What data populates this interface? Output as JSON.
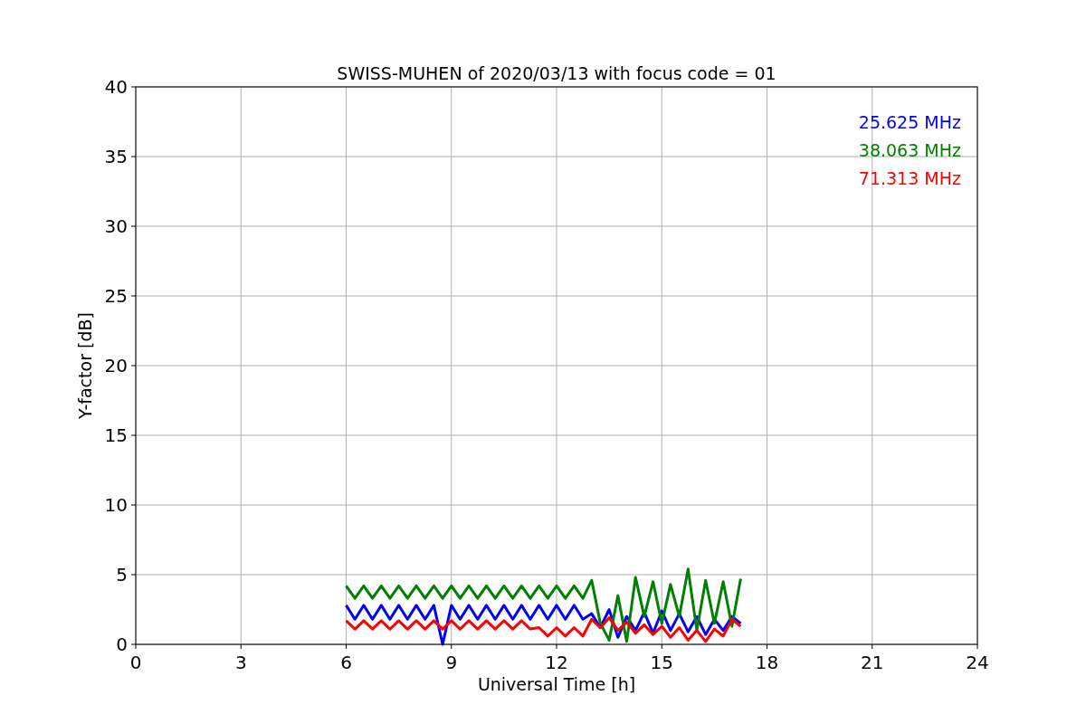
{
  "chart_data": {
    "type": "line",
    "title": "SWISS-MUHEN of 2020/03/13 with focus code = 01",
    "xlabel": "Universal Time [h]",
    "ylabel": "Y-factor [dB]",
    "x": [
      6,
      6.25,
      6.5,
      6.75,
      7,
      7.25,
      7.5,
      7.75,
      8,
      8.25,
      8.5,
      8.75,
      9,
      9.25,
      9.5,
      9.75,
      10,
      10.25,
      10.5,
      10.75,
      11,
      11.25,
      11.5,
      11.75,
      12,
      12.25,
      12.5,
      12.75,
      13,
      13.25,
      13.5,
      13.75,
      14,
      14.25,
      14.5,
      14.75,
      15,
      15.25,
      15.5,
      15.75,
      16,
      16.25,
      16.5,
      16.75,
      17,
      17.25
    ],
    "series": [
      {
        "name": "25.625 MHz",
        "color": "#0000ff",
        "values": [
          2.8,
          1.8,
          2.8,
          1.8,
          2.8,
          1.8,
          2.8,
          1.8,
          2.8,
          1.8,
          2.8,
          0,
          2.8,
          1.8,
          2.8,
          1.8,
          2.8,
          1.8,
          2.8,
          1.8,
          2.8,
          1.8,
          2.8,
          1.8,
          2.8,
          1.8,
          2.8,
          1.8,
          2.2,
          1.2,
          2.5,
          0.5,
          2.0,
          1.0,
          2.3,
          0.8,
          2.4,
          1.0,
          2.2,
          0.9,
          2.0,
          0.7,
          1.8,
          1.0,
          2.0,
          1.5
        ]
      },
      {
        "name": "38.063 MHz",
        "color": "#008000",
        "values": [
          4.2,
          3.3,
          4.2,
          3.3,
          4.2,
          3.3,
          4.2,
          3.3,
          4.2,
          3.3,
          4.2,
          3.3,
          4.2,
          3.3,
          4.2,
          3.3,
          4.2,
          3.3,
          4.2,
          3.3,
          4.2,
          3.3,
          4.2,
          3.3,
          4.2,
          3.3,
          4.2,
          3.3,
          4.6,
          1.5,
          0.3,
          3.5,
          0.2,
          4.8,
          2.0,
          4.5,
          1.5,
          4.3,
          2.0,
          5.4,
          1.0,
          4.6,
          1.5,
          4.5,
          1.3,
          4.7
        ]
      },
      {
        "name": "71.313 MHz",
        "color": "#ff0000",
        "values": [
          1.7,
          1.1,
          1.7,
          1.1,
          1.7,
          1.1,
          1.7,
          1.1,
          1.7,
          1.1,
          1.7,
          1.1,
          1.7,
          1.1,
          1.7,
          1.1,
          1.7,
          1.1,
          1.7,
          1.1,
          1.7,
          1.1,
          1.2,
          0.6,
          1.2,
          0.6,
          1.2,
          0.6,
          1.8,
          1.2,
          1.9,
          1.0,
          1.6,
          0.8,
          1.4,
          0.7,
          1.3,
          0.5,
          1.2,
          0.3,
          1.0,
          0.2,
          1.1,
          0.6,
          1.8,
          1.3
        ]
      }
    ],
    "grid": true,
    "xlim": [
      0,
      24
    ],
    "ylim": [
      0,
      40
    ],
    "xticks": [
      0,
      3,
      6,
      9,
      12,
      15,
      18,
      21,
      24
    ],
    "yticks": [
      0,
      5,
      10,
      15,
      20,
      25,
      30,
      35,
      40
    ]
  }
}
